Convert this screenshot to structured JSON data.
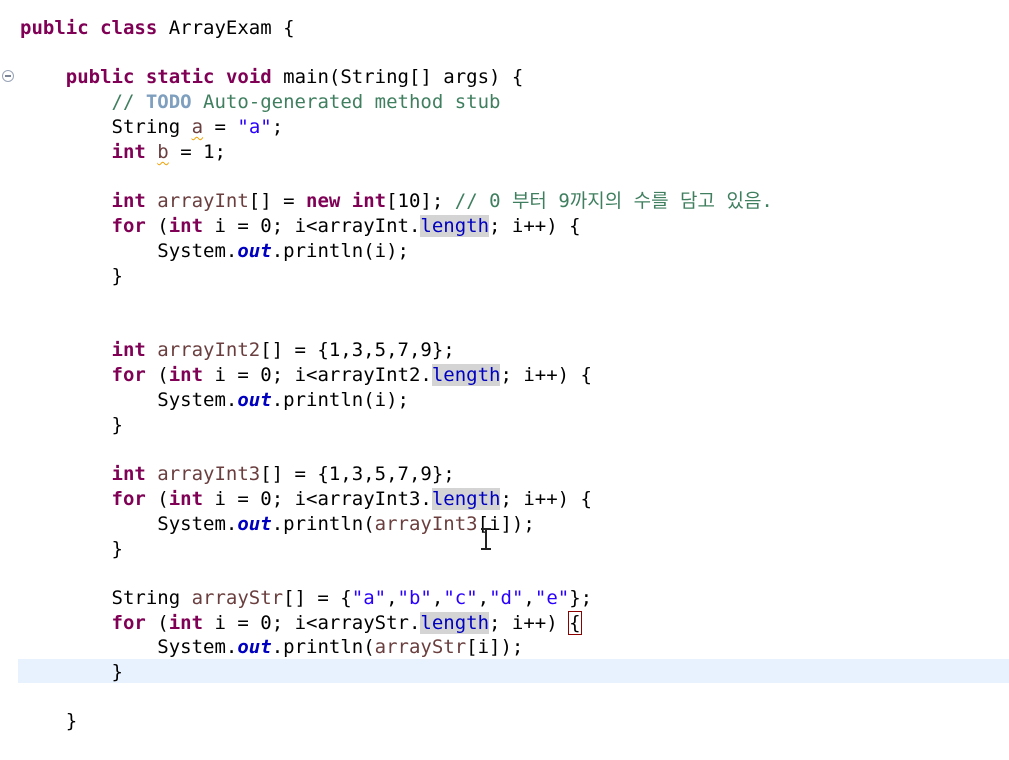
{
  "editor": {
    "class_decl": {
      "kw1": "public",
      "kw2": "class",
      "name": " ArrayExam {"
    },
    "main_decl": {
      "kw1": "public",
      "kw2": "static",
      "kw3": "void",
      "rest": " main(String[] args) {"
    },
    "comment_todo": {
      "prefix": "// ",
      "todo": "TODO",
      "text": " Auto-generated method stub"
    },
    "decl_a": {
      "type": "String ",
      "name": "a",
      "op": " = ",
      "value": "\"a\"",
      "end": ";"
    },
    "decl_b": {
      "type": "int",
      "name": "b",
      "rest": " = 1;"
    },
    "array1": {
      "decl": {
        "type": "int",
        "name": " arrayInt",
        "mid": "[] = ",
        "new_kw": "new",
        "sp": " ",
        "int_kw": "int",
        "rest": "[10]; ",
        "comment": "// 0 부터 9까지의 수를 담고 있음."
      },
      "loop": {
        "for_kw": "for",
        "open": " (",
        "int_kw": "int",
        "cond": " i = 0; i<arrayInt.",
        "length": "length",
        "tail": "; i++) {"
      },
      "print": {
        "pre": "System.",
        "out": "out",
        "post": ".println(i);"
      },
      "close": "}"
    },
    "array2": {
      "decl": {
        "type": "int",
        "name": " arrayInt2",
        "rest": "[] = {1,3,5,7,9};"
      },
      "loop": {
        "for_kw": "for",
        "open": " (",
        "int_kw": "int",
        "cond": " i = 0; i<arrayInt2.",
        "length": "length",
        "tail": "; i++) {"
      },
      "print": {
        "pre": "System.",
        "out": "out",
        "post": ".println(i);"
      },
      "close": "}"
    },
    "array3": {
      "decl": {
        "type": "int",
        "name": " arrayInt3",
        "rest": "[] = {1,3,5,7,9};"
      },
      "loop": {
        "for_kw": "for",
        "open": " (",
        "int_kw": "int",
        "cond": " i = 0; i<arrayInt3.",
        "length": "length",
        "tail": "; i++) {"
      },
      "print": {
        "pre": "System.",
        "out": "out",
        "post": ".println(",
        "arg": "arrayInt3",
        "post2": "[i]);"
      },
      "close": "}"
    },
    "array4": {
      "decl": {
        "type": "String",
        "name": " arrayStr",
        "rest": "[] = {",
        "s1": "\"a\"",
        "c1": ",",
        "s2": "\"b\"",
        "c2": ",",
        "s3": "\"c\"",
        "c3": ",",
        "s4": "\"d\"",
        "c4": ",",
        "s5": "\"e\"",
        "end": "};"
      },
      "loop": {
        "for_kw": "for",
        "open": " (",
        "int_kw": "int",
        "cond": " i = 0; i<arrayStr.",
        "length": "length",
        "tail": "; i++) ",
        "brace": "{"
      },
      "print": {
        "pre": "System.",
        "out": "out",
        "post": ".println(",
        "arg": "arrayStr",
        "post2": "[i]);"
      },
      "close": "}"
    },
    "main_close": "}"
  }
}
